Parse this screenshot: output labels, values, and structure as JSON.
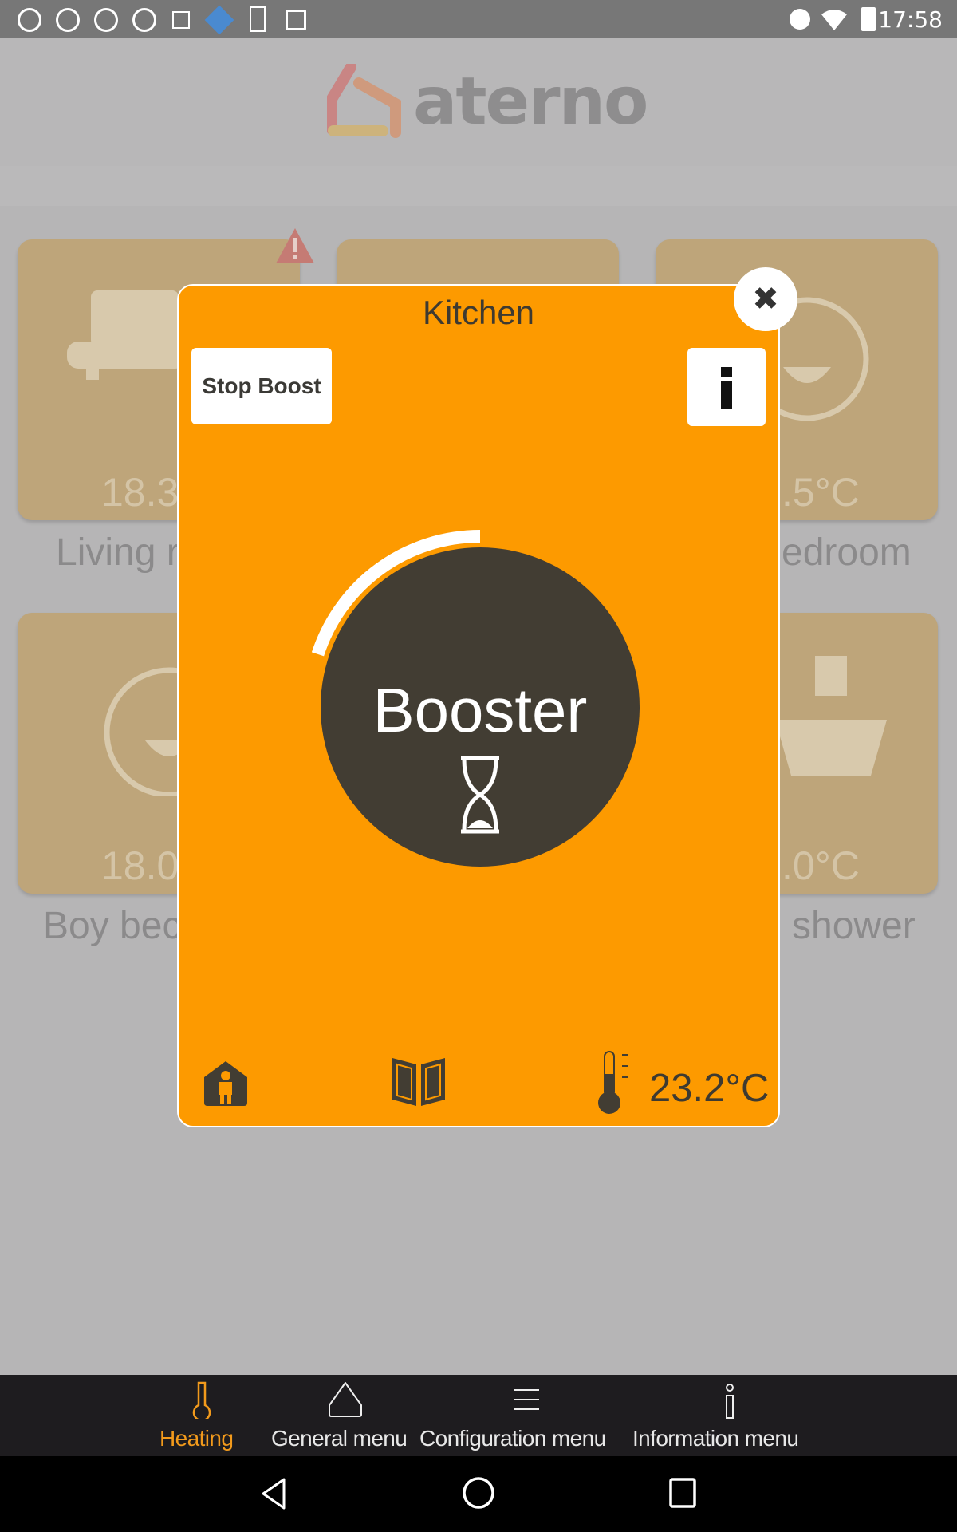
{
  "status_bar": {
    "time": "17:58",
    "icons": [
      "app-notification-icon",
      "app-notification-icon",
      "app-notification-icon",
      "app-notification-icon",
      "image-icon",
      "app-icon",
      "download-icon",
      "play-store-icon",
      "dnd-icon",
      "wifi-icon",
      "battery-icon"
    ]
  },
  "header": {
    "logo": "aterno"
  },
  "tiles": [
    {
      "temp": "18.3",
      "label": "Living r",
      "icon": "sofa-icon",
      "warning": true
    },
    {
      "temp": "",
      "label": "",
      "icon": "kitchen-icon"
    },
    {
      "temp": ".5°C",
      "label": "edroom",
      "icon": "baby-icon"
    },
    {
      "temp": "18.0",
      "label": "Boy bec",
      "icon": "baby-icon"
    },
    {
      "temp": ".0°C",
      "label": "shower",
      "icon": "bathtub-icon"
    }
  ],
  "modal": {
    "title": "Kitchen",
    "stop_boost_label": "Stop Boost",
    "mode_label": "Booster",
    "boost_progress_fraction": 0.2,
    "temperature": "23.2°C",
    "accent": "#fd9a00",
    "dial_color": "#423d33"
  },
  "bottom_nav": {
    "items": [
      {
        "label": "Heating",
        "icon": "thermometer-icon",
        "active": true
      },
      {
        "label": "General menu",
        "icon": "home-icon"
      },
      {
        "label": "Configuration menu",
        "icon": "menu-icon"
      },
      {
        "label": "Information menu",
        "icon": "info-icon"
      }
    ],
    "active_color": "#f29a1c"
  }
}
